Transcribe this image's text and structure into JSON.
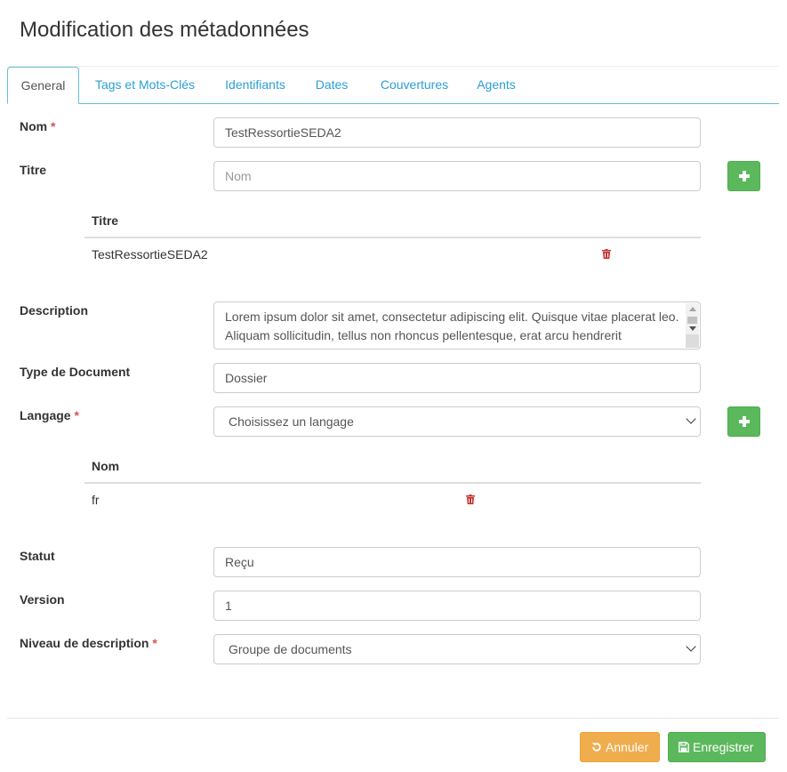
{
  "page": {
    "title": "Modification des métadonnées"
  },
  "tabs": [
    {
      "label": "General",
      "active": true
    },
    {
      "label": "Tags et Mots-Clés",
      "active": false
    },
    {
      "label": "Identifiants",
      "active": false
    },
    {
      "label": "Dates",
      "active": false
    },
    {
      "label": "Couvertures",
      "active": false
    },
    {
      "label": "Agents",
      "active": false
    }
  ],
  "form": {
    "nom": {
      "label": "Nom",
      "required_mark": "*",
      "value": "TestRessortieSEDA2"
    },
    "titre": {
      "label": "Titre",
      "placeholder": "Nom",
      "table_header": "Titre",
      "rows": [
        "TestRessortieSEDA2"
      ]
    },
    "description": {
      "label": "Description",
      "value": "Lorem ipsum dolor sit amet, consectetur adipiscing elit. Quisque vitae placerat leo. Aliquam sollicitudin, tellus non rhoncus pellentesque, erat arcu hendrerit"
    },
    "type_document": {
      "label": "Type de Document",
      "value": "Dossier"
    },
    "langage": {
      "label": "Langage",
      "required_mark": "*",
      "selected": "Choisissez un langage",
      "table_header": "Nom",
      "rows": [
        "fr"
      ]
    },
    "statut": {
      "label": "Statut",
      "value": "Reçu"
    },
    "version": {
      "label": "Version",
      "value": "1"
    },
    "niveau_description": {
      "label": "Niveau de description",
      "required_mark": "*",
      "selected": "Groupe de documents"
    }
  },
  "footer": {
    "cancel_label": "Annuler",
    "save_label": "Enregistrer"
  },
  "colors": {
    "accent": "#2a9fd6",
    "success": "#5cb85c",
    "warning": "#f0ad4e",
    "danger": "#d9534f",
    "trash": "#c9302c"
  }
}
